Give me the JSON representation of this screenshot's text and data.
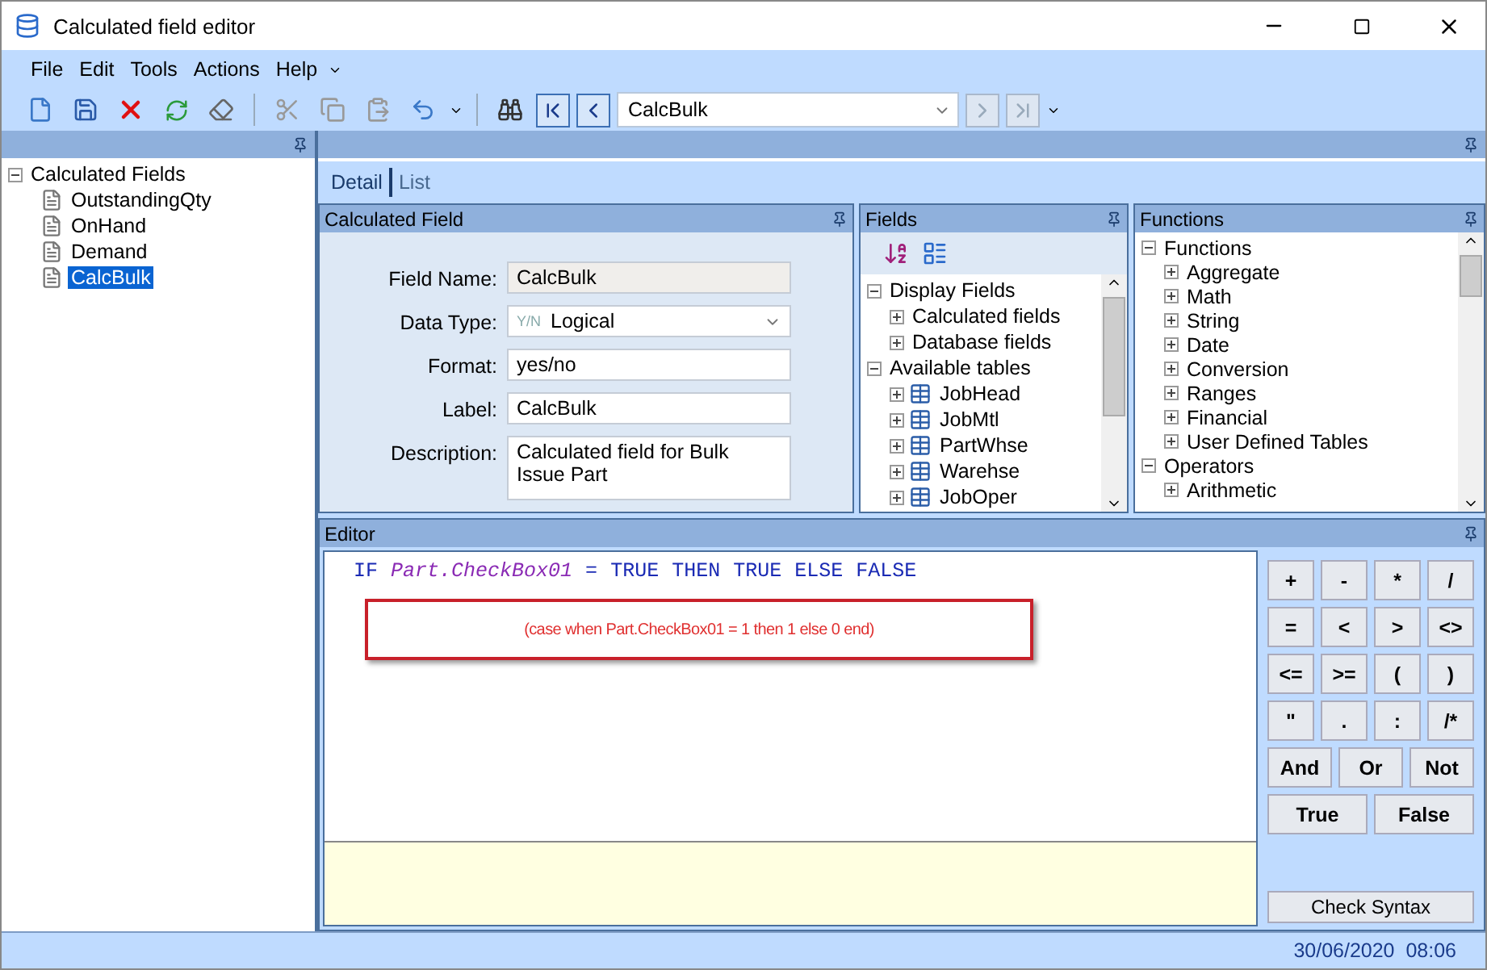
{
  "window": {
    "title": "Calculated field editor"
  },
  "menu": [
    "File",
    "Edit",
    "Tools",
    "Actions",
    "Help"
  ],
  "toolbar": {
    "record_combo": "CalcBulk"
  },
  "tree": {
    "label": "Calculated Fields",
    "expanded": true,
    "children": [
      {
        "label": "OutstandingQty",
        "selected": false
      },
      {
        "label": "OnHand",
        "selected": false
      },
      {
        "label": "Demand",
        "selected": false
      },
      {
        "label": "CalcBulk",
        "selected": true
      }
    ]
  },
  "tabs": [
    {
      "label": "Detail",
      "selected": true
    },
    {
      "label": "List",
      "selected": false
    }
  ],
  "calculated_field": {
    "title": "Calculated Field",
    "fields": [
      {
        "label": "Field Name:",
        "kind": "readonly",
        "value": "CalcBulk"
      },
      {
        "label": "Data Type:",
        "kind": "combo",
        "badge": "Y/N",
        "value": "Logical"
      },
      {
        "label": "Format:",
        "kind": "text",
        "value": "yes/no"
      },
      {
        "label": "Label:",
        "kind": "text",
        "value": "CalcBulk"
      },
      {
        "label": "Description:",
        "kind": "multiline",
        "value": "Calculated field for Bulk Issue Part"
      }
    ]
  },
  "fields_panel": {
    "title": "Fields",
    "tree": [
      {
        "label": "Display Fields",
        "expanded": true,
        "children": [
          {
            "label": "Calculated fields",
            "expanded": false
          },
          {
            "label": "Database fields",
            "expanded": false
          }
        ]
      },
      {
        "label": "Available tables",
        "expanded": true,
        "children": [
          {
            "label": "JobHead",
            "expanded": false,
            "kind": "table"
          },
          {
            "label": "JobMtl",
            "expanded": false,
            "kind": "table"
          },
          {
            "label": "PartWhse",
            "expanded": false,
            "kind": "table"
          },
          {
            "label": "Warehse",
            "expanded": false,
            "kind": "table"
          },
          {
            "label": "JobOper",
            "expanded": false,
            "kind": "table"
          }
        ]
      }
    ]
  },
  "functions_panel": {
    "title": "Functions",
    "tree": [
      {
        "label": "Functions",
        "expanded": true,
        "children": [
          {
            "label": "Aggregate",
            "expanded": false
          },
          {
            "label": "Math",
            "expanded": false
          },
          {
            "label": "String",
            "expanded": false
          },
          {
            "label": "Date",
            "expanded": false
          },
          {
            "label": "Conversion",
            "expanded": false
          },
          {
            "label": "Ranges",
            "expanded": false
          },
          {
            "label": "Financial",
            "expanded": false
          },
          {
            "label": "User Defined Tables",
            "expanded": false
          }
        ]
      },
      {
        "label": "Operators",
        "expanded": true,
        "children": [
          {
            "label": "Arithmetic",
            "expanded": false
          }
        ]
      }
    ]
  },
  "editor": {
    "title": "Editor",
    "code": [
      {
        "text": "IF",
        "kind": "keyword"
      },
      {
        "text": "Part.CheckBox01",
        "kind": "identifier"
      },
      {
        "text": "=",
        "kind": "operator"
      },
      {
        "text": "TRUE",
        "kind": "keyword"
      },
      {
        "text": "THEN",
        "kind": "keyword"
      },
      {
        "text": "TRUE",
        "kind": "keyword"
      },
      {
        "text": "ELSE",
        "kind": "keyword"
      },
      {
        "text": "FALSE",
        "kind": "keyword"
      }
    ],
    "annotation": "(case when  Part.CheckBox01 = 1  then  1  else  0 end)",
    "operator_rows": [
      [
        "+",
        "-",
        "*",
        "/"
      ],
      [
        "=",
        "<",
        ">",
        "<>"
      ],
      [
        "<=",
        ">=",
        "(",
        ")"
      ],
      [
        "\"",
        ".",
        ":",
        "/*"
      ],
      [
        "And",
        "Or",
        "Not"
      ],
      [
        "True",
        "False"
      ]
    ],
    "check_button": "Check Syntax"
  },
  "status_bar": {
    "datetime": "30/06/2020  08:06"
  }
}
